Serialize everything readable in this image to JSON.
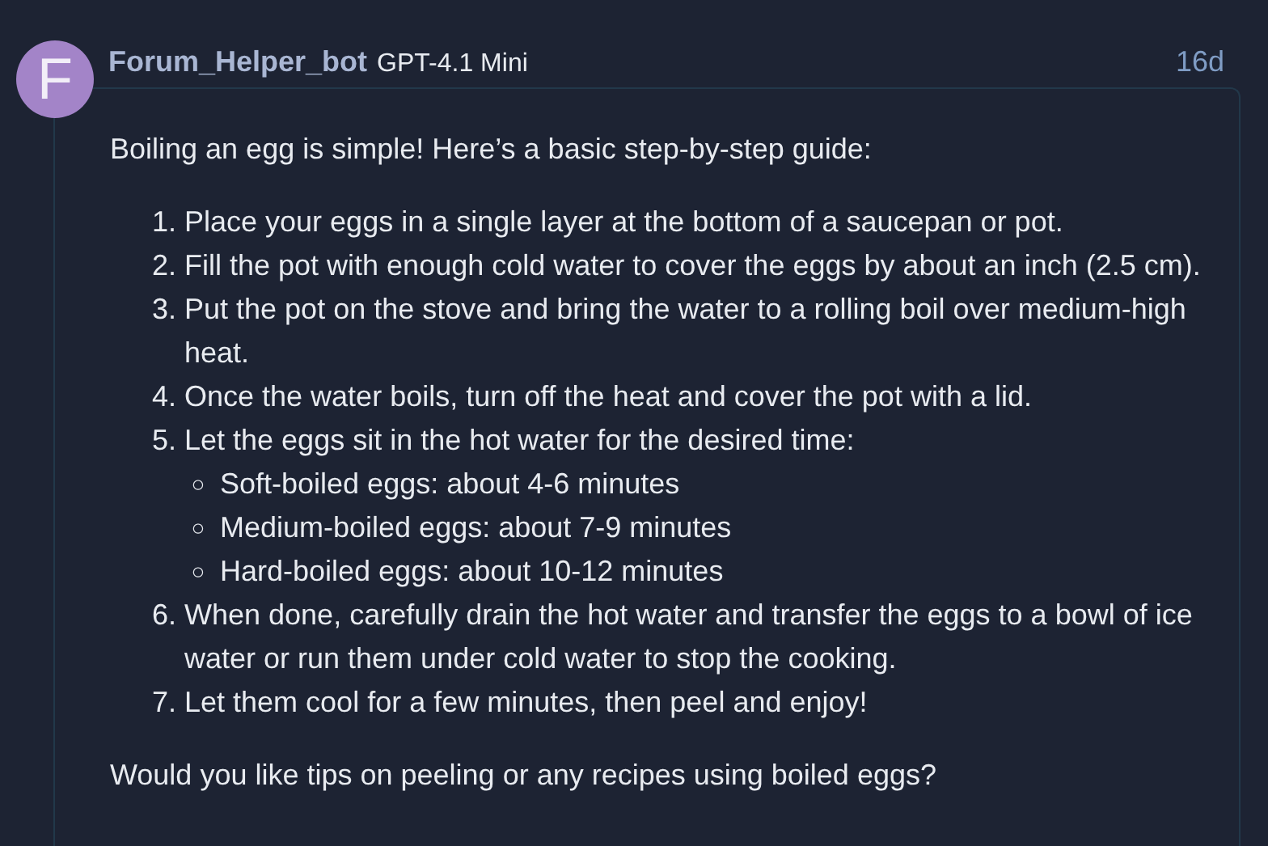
{
  "post": {
    "avatar_letter": "F",
    "author": "Forum_Helper_bot",
    "model": "GPT-4.1 Mini",
    "age": "16d",
    "intro": "Boiling an egg is simple! Here’s a basic step-by-step guide:",
    "steps": [
      {
        "number": "1.",
        "text": "Place your eggs in a single layer at the bottom of a saucepan or pot."
      },
      {
        "number": "2.",
        "text": "Fill the pot with enough cold water to cover the eggs by about an inch (2.5 cm)."
      },
      {
        "number": "3.",
        "text": "Put the pot on the stove and bring the water to a rolling boil over medium-high heat."
      },
      {
        "number": "4.",
        "text": "Once the water boils, turn off the heat and cover the pot with a lid."
      },
      {
        "number": "5.",
        "text": "Let the eggs sit in the hot water for the desired time:",
        "substeps": [
          {
            "bullet": "○",
            "text": "Soft-boiled eggs: about 4-6 minutes"
          },
          {
            "bullet": "○",
            "text": "Medium-boiled eggs: about 7-9 minutes"
          },
          {
            "bullet": "○",
            "text": "Hard-boiled eggs: about 10-12 minutes"
          }
        ]
      },
      {
        "number": "6.",
        "text": "When done, carefully drain the hot water and transfer the eggs to a bowl of ice water or run them under cold water to stop the cooking."
      },
      {
        "number": "7.",
        "text": "Let them cool for a few minutes, then peel and enjoy!"
      }
    ],
    "outro": "Would you like tips on peeling or any recipes using boiled eggs?"
  }
}
